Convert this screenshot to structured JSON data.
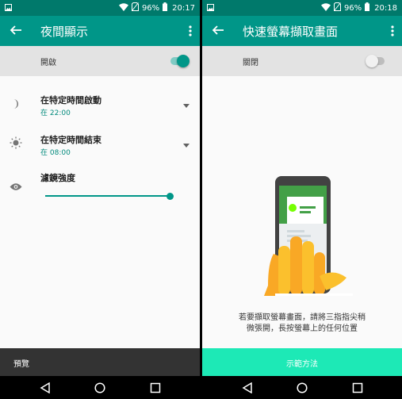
{
  "left": {
    "status": {
      "battery": "96%",
      "time": "20:17"
    },
    "toolbar": {
      "title": "夜間顯示"
    },
    "master_switch": {
      "label": "開啟",
      "state": "on"
    },
    "start_setting": {
      "title": "在特定時間啟動",
      "subtitle": "在 22:00"
    },
    "end_setting": {
      "title": "在特定時間結束",
      "subtitle": "在 08:00"
    },
    "filter_setting": {
      "title": "濾鏡強度",
      "level": 1.0
    },
    "bottom_bar": {
      "label": "預覽"
    }
  },
  "right": {
    "status": {
      "battery": "96%",
      "time": "20:18"
    },
    "toolbar": {
      "title": "快速螢幕擷取畫面"
    },
    "master_switch": {
      "label": "關閉",
      "state": "off"
    },
    "description": {
      "line1": "若要擷取螢幕畫面，請將三指指尖稍",
      "line2": "微張開，長按螢幕上的任何位置"
    },
    "bottom_bar": {
      "label": "示範方法"
    }
  },
  "colors": {
    "status_bar": "#00796b",
    "toolbar": "#009688",
    "accent": "#009688",
    "accent_text": "#00897b",
    "demo_button": "#1de9b6",
    "preview_bar": "#333333"
  },
  "icons": [
    "image-icon",
    "wifi-icon",
    "no-sim-icon",
    "battery-icon",
    "back-arrow-icon",
    "overflow-menu-icon",
    "moon-icon",
    "sun-icon",
    "eye-icon",
    "dropdown-icon",
    "nav-back-icon",
    "nav-home-icon",
    "nav-recents-icon"
  ]
}
